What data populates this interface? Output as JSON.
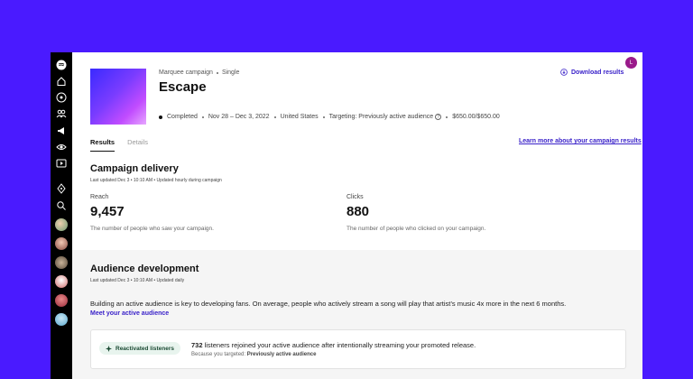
{
  "campaign": {
    "type": "Marquee campaign",
    "format": "Single",
    "title": "Escape",
    "status": "Completed",
    "dates": "Nov 28 – Dec 3, 2022",
    "location": "United States",
    "targeting": "Targeting: Previously active audience",
    "budget": "$650.00/$650.00"
  },
  "header": {
    "download_label": "Download results",
    "user_initial": "L"
  },
  "tabs": [
    {
      "label": "Results",
      "active": true
    },
    {
      "label": "Details",
      "active": false
    }
  ],
  "learn_more_link": "Learn more about your campaign results",
  "delivery": {
    "title": "Campaign delivery",
    "note": "Last updated Dec 3 • 10:10 AM • Updated hourly during campaign",
    "reach": {
      "label": "Reach",
      "value": "9,457",
      "desc": "The number of people who saw your campaign."
    },
    "clicks": {
      "label": "Clicks",
      "value": "880",
      "desc": "The number of people who clicked on your campaign."
    }
  },
  "audience": {
    "title": "Audience development",
    "note": "Last updated Dec 3 • 10:10 AM • Updated daily",
    "text": "Building an active audience is key to developing fans. On average, people who actively stream a song will play that artist’s music 4x more in the next 6 months.",
    "link": "Meet your active audience",
    "card": {
      "pill": "Reactivated listeners",
      "count": "732",
      "text": " listeners rejoined your active audience after intentionally streaming your promoted release.",
      "sub_prefix": "Because you targeted: ",
      "sub_value": "Previously active audience"
    }
  },
  "colors": {
    "background": "#4a1aff",
    "accent": "#3a22c9",
    "sidebar": "#000000",
    "user_badge": "#9a1a8a"
  },
  "sidebar_icons": [
    "logo-icon",
    "home-icon",
    "music-icon",
    "audience-icon",
    "megaphone-icon",
    "eye-icon",
    "video-icon",
    "compass-icon",
    "search-icon"
  ]
}
